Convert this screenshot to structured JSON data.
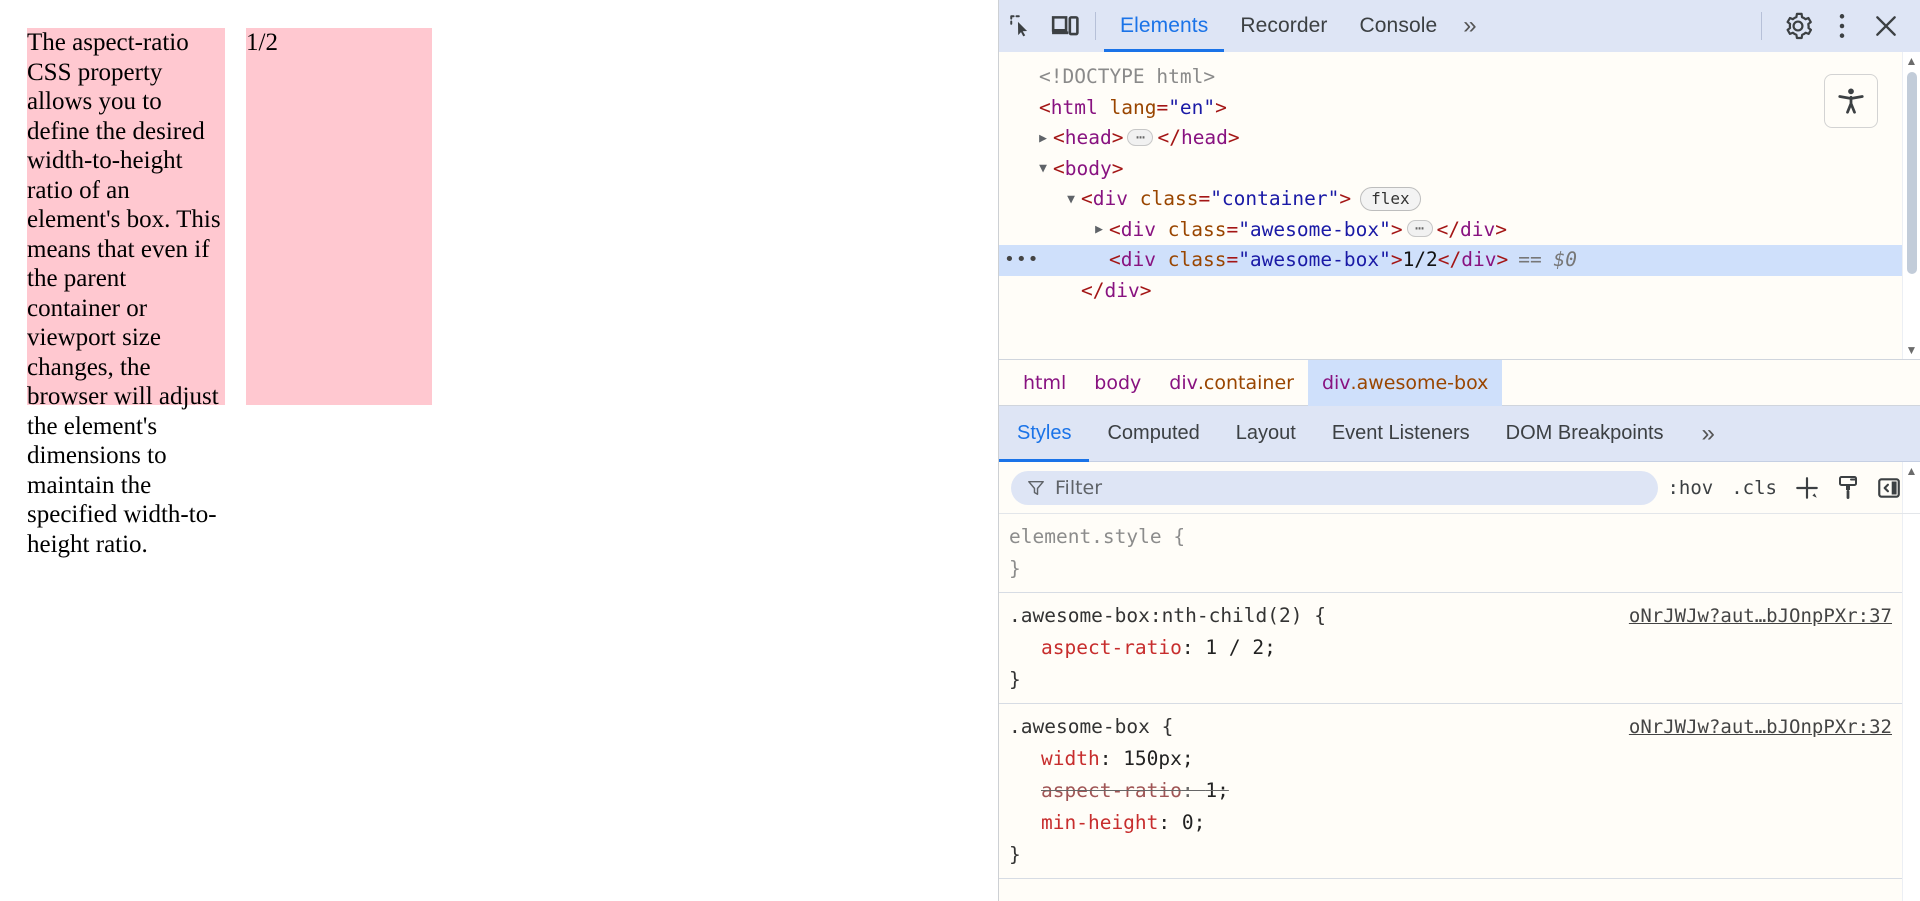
{
  "page": {
    "box1_text": "The aspect-ratio CSS property allows you to define the desired width-to-height ratio of an element's box. This means that even if the parent container or viewport size changes, the browser will adjust the element's dimensions to maintain the specified width-to-height ratio.",
    "box2_text": "1/2",
    "box_color": "#ffc8d0"
  },
  "devtools": {
    "toolbar": {
      "inspect_icon": "inspect-element-icon",
      "device_icon": "device-toolbar-icon",
      "tabs": [
        {
          "label": "Elements",
          "active": true
        },
        {
          "label": "Recorder",
          "active": false
        },
        {
          "label": "Console",
          "active": false
        }
      ],
      "more_tabs_label": "»",
      "settings_icon": "gear-icon",
      "menu_icon": "vertical-dots-icon",
      "close_icon": "close-icon",
      "accent_color": "#1a73e8",
      "background": "#dee5f5"
    },
    "dom": {
      "a11y_button_icon": "accessibility-icon",
      "rows": [
        {
          "indent": 0,
          "twisty": "",
          "kind": "doctype",
          "text": "<!DOCTYPE html>"
        },
        {
          "indent": 0,
          "twisty": "",
          "kind": "open",
          "tag": "html",
          "attr_name": "lang",
          "attr_value": "\"en\""
        },
        {
          "indent": 0,
          "twisty": "▶",
          "kind": "collapsed",
          "tag": "head"
        },
        {
          "indent": 0,
          "twisty": "▼",
          "kind": "open",
          "tag": "body"
        },
        {
          "indent": 1,
          "twisty": "▼",
          "kind": "open",
          "tag": "div",
          "attr_name": "class",
          "attr_value": "\"container\"",
          "badge": "flex"
        },
        {
          "indent": 2,
          "twisty": "▶",
          "kind": "collapsed",
          "tag": "div",
          "attr_name": "class",
          "attr_value": "\"awesome-box\""
        },
        {
          "indent": 2,
          "twisty": "",
          "kind": "selected",
          "tag": "div",
          "attr_name": "class",
          "attr_value": "\"awesome-box\"",
          "text_content": "1/2",
          "suffix": "== $0",
          "row_dots": "•••"
        },
        {
          "indent": 1,
          "twisty": "",
          "kind": "close",
          "tag": "div"
        }
      ]
    },
    "breadcrumb": [
      {
        "label": "html",
        "cls": "",
        "active": false
      },
      {
        "label": "body",
        "cls": "",
        "active": false
      },
      {
        "label": "div",
        "cls": ".container",
        "active": false
      },
      {
        "label": "div",
        "cls": ".awesome-box",
        "active": true
      }
    ],
    "sidebar_tabs": [
      {
        "label": "Styles",
        "active": true
      },
      {
        "label": "Computed",
        "active": false
      },
      {
        "label": "Layout",
        "active": false
      },
      {
        "label": "Event Listeners",
        "active": false
      },
      {
        "label": "DOM Breakpoints",
        "active": false
      }
    ],
    "sidebar_more_label": "»",
    "filter_row": {
      "filter_icon": "funnel-icon",
      "placeholder": "Filter",
      "value": "",
      "hov_label": ":hov",
      "cls_label": ".cls",
      "new_rule_icon": "plus-icon",
      "class_style_icon": "paintbrush-icon",
      "toggle_sidebar_icon": "panel-toggle-icon"
    },
    "rules": [
      {
        "selector": "element.style {",
        "muted": true,
        "origin": "",
        "declarations": [],
        "closing": "}"
      },
      {
        "selector": ".awesome-box:nth-child(2) {",
        "muted": false,
        "origin": "oNrJWJw?aut…bJOnpPXr:37",
        "declarations": [
          {
            "prop": "aspect-ratio",
            "value": "1 / 2;",
            "disabled": false
          }
        ],
        "closing": "}"
      },
      {
        "selector": ".awesome-box {",
        "muted": false,
        "origin": "oNrJWJw?aut…bJOnpPXr:32",
        "declarations": [
          {
            "prop": "width",
            "value": "150px;",
            "disabled": false
          },
          {
            "prop": "aspect-ratio",
            "value": "1;",
            "disabled": true
          },
          {
            "prop": "min-height",
            "value": "0;",
            "disabled": false
          }
        ],
        "closing": "}"
      }
    ]
  }
}
